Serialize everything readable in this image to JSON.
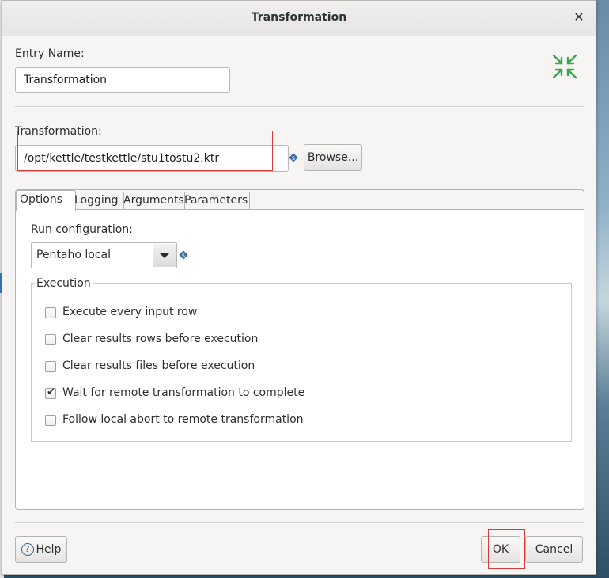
{
  "window": {
    "title": "Transformation",
    "close_icon": "close-icon"
  },
  "entry": {
    "label": "Entry Name:",
    "value": "Transformation"
  },
  "transformation": {
    "label": "Transformation:",
    "path": "/opt/kettle/testkettle/stu1tostu2.ktr",
    "browse_label": "Browse..."
  },
  "tabs": [
    {
      "label": "Options",
      "active": true
    },
    {
      "label": "Logging",
      "active": false
    },
    {
      "label": "Arguments",
      "active": false
    },
    {
      "label": "Parameters",
      "active": false
    }
  ],
  "options": {
    "run_config_label": "Run configuration:",
    "run_config_value": "Pentaho local",
    "execution_title": "Execution",
    "checks": [
      {
        "label": "Execute every input row",
        "checked": false
      },
      {
        "label": "Clear results rows before execution",
        "checked": false
      },
      {
        "label": "Clear results files before execution",
        "checked": false
      },
      {
        "label": "Wait for remote transformation to complete",
        "checked": true
      },
      {
        "label": "Follow local abort to remote transformation",
        "checked": false
      }
    ]
  },
  "footer": {
    "help_label": "Help",
    "ok_label": "OK",
    "cancel_label": "Cancel"
  },
  "colors": {
    "collapse_icon": "#3aa84a",
    "highlight_box": "#d63a3a",
    "variable_icon": "#3d6d9e"
  }
}
